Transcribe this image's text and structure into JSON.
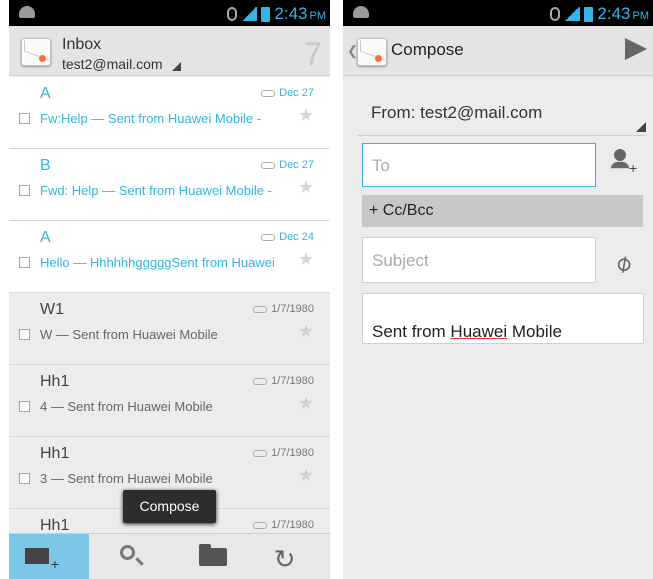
{
  "status": {
    "time": "2:43",
    "ampm": "PM"
  },
  "inbox": {
    "title": "Inbox",
    "account": "test2@mail.com",
    "unread_count": "7",
    "messages": [
      {
        "sender": "A",
        "date": "Dec 27",
        "snippet": "Fw:Help — Sent from Huawei Mobile -"
      },
      {
        "sender": "B",
        "date": "Dec 27",
        "snippet": "Fwd: Help — Sent from Huawei Mobile -"
      },
      {
        "sender": "A",
        "date": "Dec 24",
        "snippet": "Hello — HhhhhhgggggSent from Huawei"
      },
      {
        "sender": "W1",
        "date": "1/7/1980",
        "snippet": "W — Sent from Huawei Mobile"
      },
      {
        "sender": "Hh1",
        "date": "1/7/1980",
        "snippet": "4 — Sent from Huawei Mobile"
      },
      {
        "sender": "Hh1",
        "date": "1/7/1980",
        "snippet": "3 — Sent from Huawei Mobile"
      },
      {
        "sender": "Hh1",
        "date": "1/7/1980",
        "snippet": ""
      }
    ],
    "toast": "Compose"
  },
  "compose": {
    "title": "Compose",
    "from": "From: test2@mail.com",
    "to_placeholder": "To",
    "cc_bcc": "+ Cc/Bcc",
    "subject_placeholder": "Subject",
    "body_prefix": "Sent from ",
    "body_brand": "Huawei",
    "body_suffix": " Mobile"
  },
  "icons": {
    "bottom": [
      "compose-icon",
      "search-icon",
      "folder-icon",
      "refresh-icon"
    ],
    "compose": [
      "back-icon",
      "mail-icon",
      "send-icon",
      "add-person-icon",
      "attachment-icon"
    ]
  },
  "colors": {
    "accent": "#33b5e5",
    "toast": "#2d2d2d",
    "active_tab": "#7cc6e8"
  }
}
